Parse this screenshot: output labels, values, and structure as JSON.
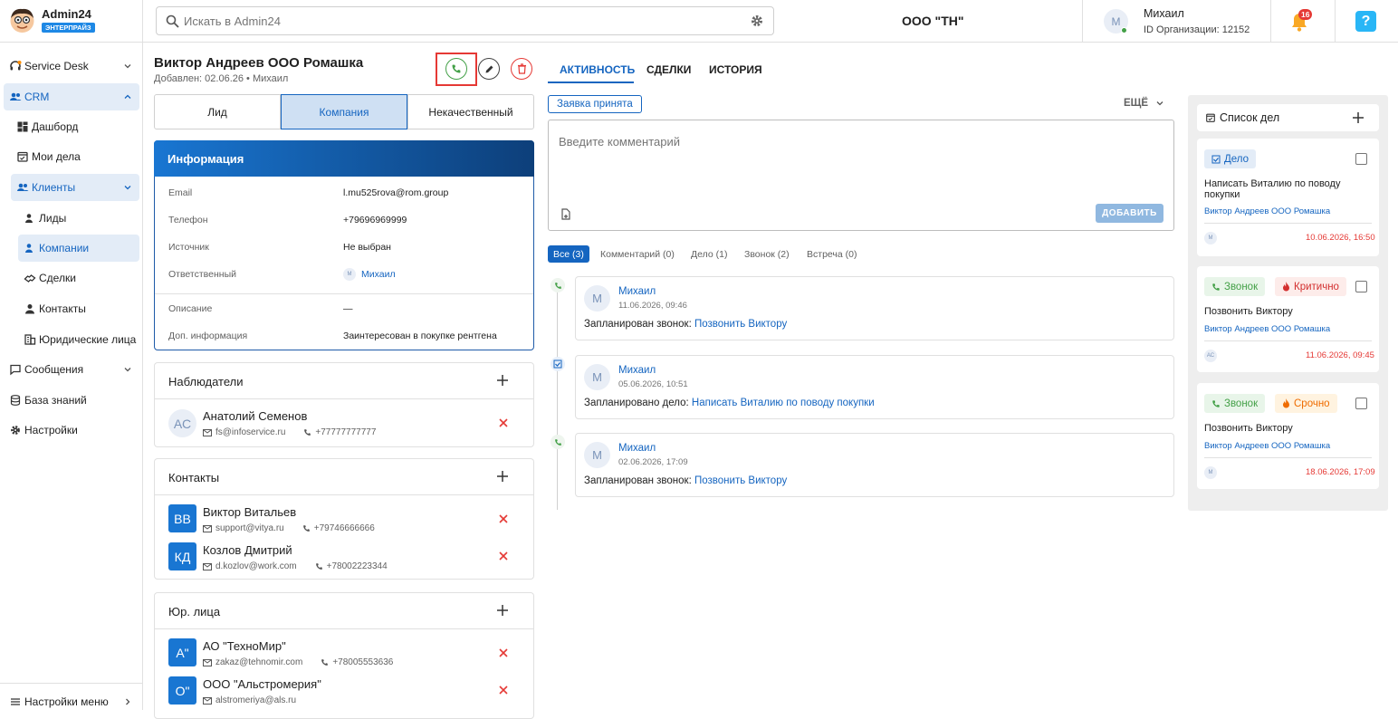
{
  "app": {
    "name": "Admin24",
    "plan": "ЭНТЕРПРАЙЗ"
  },
  "search": {
    "placeholder": "Искать в Admin24"
  },
  "header": {
    "company": "ООО \"ТН\"",
    "user_initial": "М",
    "user_name": "Михаил",
    "org_id": "ID Организации: 12152",
    "notif_count": "16"
  },
  "sidebar": {
    "items": [
      {
        "label": "Service Desk"
      },
      {
        "label": "CRM"
      },
      {
        "label": "Дашборд"
      },
      {
        "label": "Мои дела"
      },
      {
        "label": "Клиенты"
      },
      {
        "label": "Лиды"
      },
      {
        "label": "Компании"
      },
      {
        "label": "Сделки"
      },
      {
        "label": "Контакты"
      },
      {
        "label": "Юридические лица"
      },
      {
        "label": "Сообщения"
      },
      {
        "label": "База знаний"
      },
      {
        "label": "Настройки"
      }
    ],
    "footer": "Настройки меню"
  },
  "entity": {
    "title": "Виктор Андреев ООО Ромашка",
    "added": "Добавлен: 02.06.26 • Михаил"
  },
  "status_tabs": [
    "Лид",
    "Компания",
    "Некачественный"
  ],
  "info": {
    "title": "Информация",
    "rows": [
      {
        "label": "Email",
        "value": "l.mu525rova@rom.group"
      },
      {
        "label": "Телефон",
        "value": "+79696969999"
      },
      {
        "label": "Источник",
        "value": "Не выбран"
      },
      {
        "label": "Ответственный",
        "value": "Михаил",
        "avatar": "М"
      },
      {
        "label": "Описание",
        "value": "—"
      },
      {
        "label": "Доп. информация",
        "value": "Заинтересован в покупке рентгена"
      }
    ]
  },
  "observers": {
    "title": "Наблюдатели",
    "items": [
      {
        "initials": "АС",
        "name": "Анатолий Семенов",
        "email": "fs@infoservice.ru",
        "phone": "+77777777777"
      }
    ]
  },
  "contacts": {
    "title": "Контакты",
    "items": [
      {
        "initials": "ВВ",
        "name": "Виктор Витальев",
        "email": "support@vitya.ru",
        "phone": "+79746666666"
      },
      {
        "initials": "КД",
        "name": "Козлов Дмитрий",
        "email": "d.kozlov@work.com",
        "phone": "+78002223344"
      }
    ]
  },
  "legal": {
    "title": "Юр. лица",
    "items": [
      {
        "initials": "А\"",
        "name": "АО \"ТехноМир\"",
        "email": "zakaz@tehnomir.com",
        "phone": "+78005553636"
      },
      {
        "initials": "О\"",
        "name": "ООО \"Альстромерия\"",
        "email": "alstromeriya@als.ru",
        "phone": ""
      }
    ]
  },
  "activity_tabs": [
    "АКТИВНОСТЬ",
    "СДЕЛКИ",
    "ИСТОРИЯ"
  ],
  "status_chip": "Заявка принята",
  "more": "ЕЩЁ",
  "comment": {
    "placeholder": "Введите комментарий",
    "add": "ДОБАВИТЬ"
  },
  "filters": [
    "Все (3)",
    "Комментарий (0)",
    "Дело (1)",
    "Звонок (2)",
    "Встреча (0)"
  ],
  "feed": [
    {
      "avatar": "М",
      "author": "Михаил",
      "date": "11.06.2026, 09:46",
      "prefix": "Запланирован звонок:",
      "link": "Позвонить Виктору",
      "type": "call"
    },
    {
      "avatar": "М",
      "author": "Михаил",
      "date": "05.06.2026, 10:51",
      "prefix": "Запланировано дело:",
      "link": "Написать Виталию по поводу покупки",
      "type": "task"
    },
    {
      "avatar": "М",
      "author": "Михаил",
      "date": "02.06.2026, 17:09",
      "prefix": "Запланирован звонок:",
      "link": "Позвонить Виктору",
      "type": "call"
    }
  ],
  "todo": {
    "title": "Список дел",
    "items": [
      {
        "badge": "Дело",
        "priority": "",
        "title": "Написать Виталию по поводу покупки",
        "link": "Виктор Андреев ООО Ромашка",
        "avatar": "М",
        "date": "10.06.2026, 16:50"
      },
      {
        "badge": "Звонок",
        "priority": "Критично",
        "title": "Позвонить Виктору",
        "link": "Виктор Андреев ООО Ромашка",
        "avatar": "АС",
        "date": "11.06.2026, 09:45"
      },
      {
        "badge": "Звонок",
        "priority": "Срочно",
        "title": "Позвонить Виктору",
        "link": "Виктор Андреев ООО Ромашка",
        "avatar": "М",
        "date": "18.06.2026, 17:09"
      }
    ]
  },
  "colors": {
    "primary": "#1565c0",
    "danger": "#e53935",
    "green": "#43a047",
    "orange": "#fb8c00"
  }
}
